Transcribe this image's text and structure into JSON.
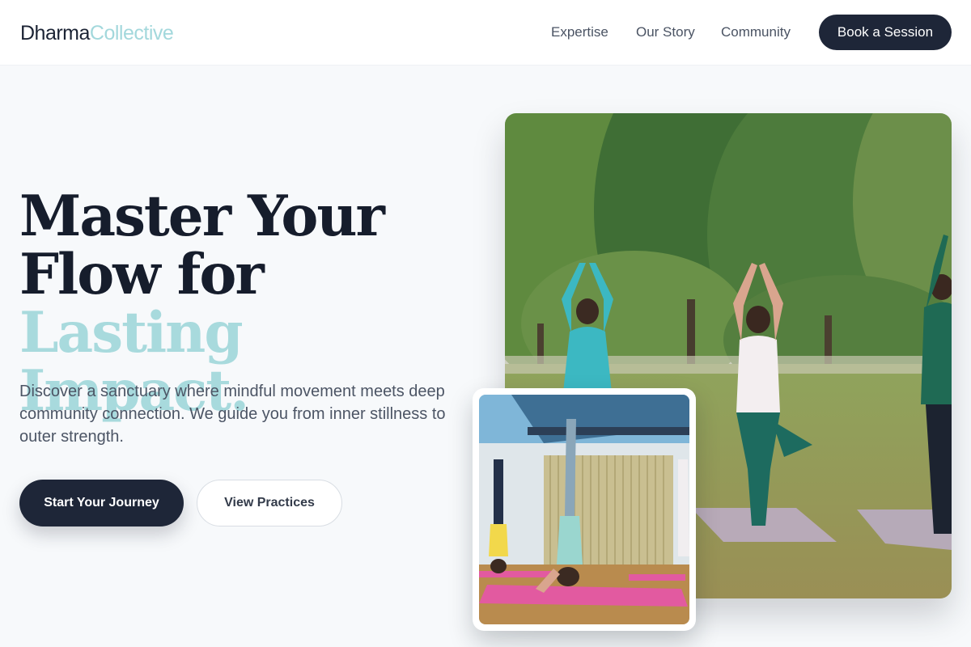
{
  "brand": {
    "name_dark": "Dharma",
    "name_light": "Collective"
  },
  "nav": {
    "items": [
      {
        "label": "Expertise"
      },
      {
        "label": "Our Story"
      },
      {
        "label": "Community"
      }
    ],
    "cta_label": "Book a Session"
  },
  "hero": {
    "headline_line1": "Master Your",
    "headline_line2a": "Flow for ",
    "headline_line2b": "Lasting",
    "headline_line3": "Impact.",
    "subtext": "Discover a sanctuary where mindful movement meets deep community connection. We guide you from inner stillness to outer strength.",
    "primary_button": "Start Your Journey",
    "secondary_button": "View Practices"
  },
  "images": {
    "main": "outdoor-group-yoga-photo",
    "inset": "indoor-headstand-yoga-photo"
  },
  "colors": {
    "primary": "#1e2638",
    "accent": "#a8dadd",
    "background": "#f7f9fb"
  }
}
